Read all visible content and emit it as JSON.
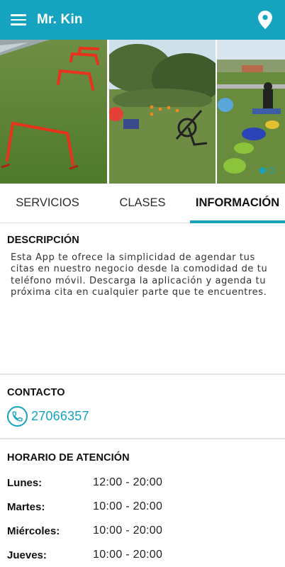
{
  "appbar": {
    "title": "Mr. Kin",
    "menu_icon": "hamburger-menu-icon",
    "location_icon": "map-pin-icon"
  },
  "colors": {
    "accent": "#15a3bf",
    "text": "#222222",
    "divider": "#e4e4e4"
  },
  "gallery": {
    "pages": 2,
    "active_page": 1
  },
  "tabs": [
    {
      "label": "SERVICIOS",
      "active": false
    },
    {
      "label": "CLASES",
      "active": false
    },
    {
      "label": "INFORMACIÓN",
      "active": true
    }
  ],
  "description": {
    "title": "DESCRIPCIÓN",
    "text": "Esta App te ofrece la simplicidad de agendar tus citas en nuestro negocio desde la comodidad de tu teléfono móvil. Descarga la aplicación y agenda tu próxima cita en cualquier parte que te encuentres."
  },
  "contact": {
    "title": "CONTACTO",
    "phone": "27066357",
    "phone_icon": "phone-icon"
  },
  "hours": {
    "title": "HORARIO DE ATENCIÓN",
    "rows": [
      {
        "day": "Lunes:",
        "time": "12:00 - 20:00"
      },
      {
        "day": "Martes:",
        "time": "10:00 - 20:00"
      },
      {
        "day": "Miércoles:",
        "time": "10:00 - 20:00"
      },
      {
        "day": "Jueves:",
        "time": "10:00 - 20:00"
      }
    ]
  }
}
